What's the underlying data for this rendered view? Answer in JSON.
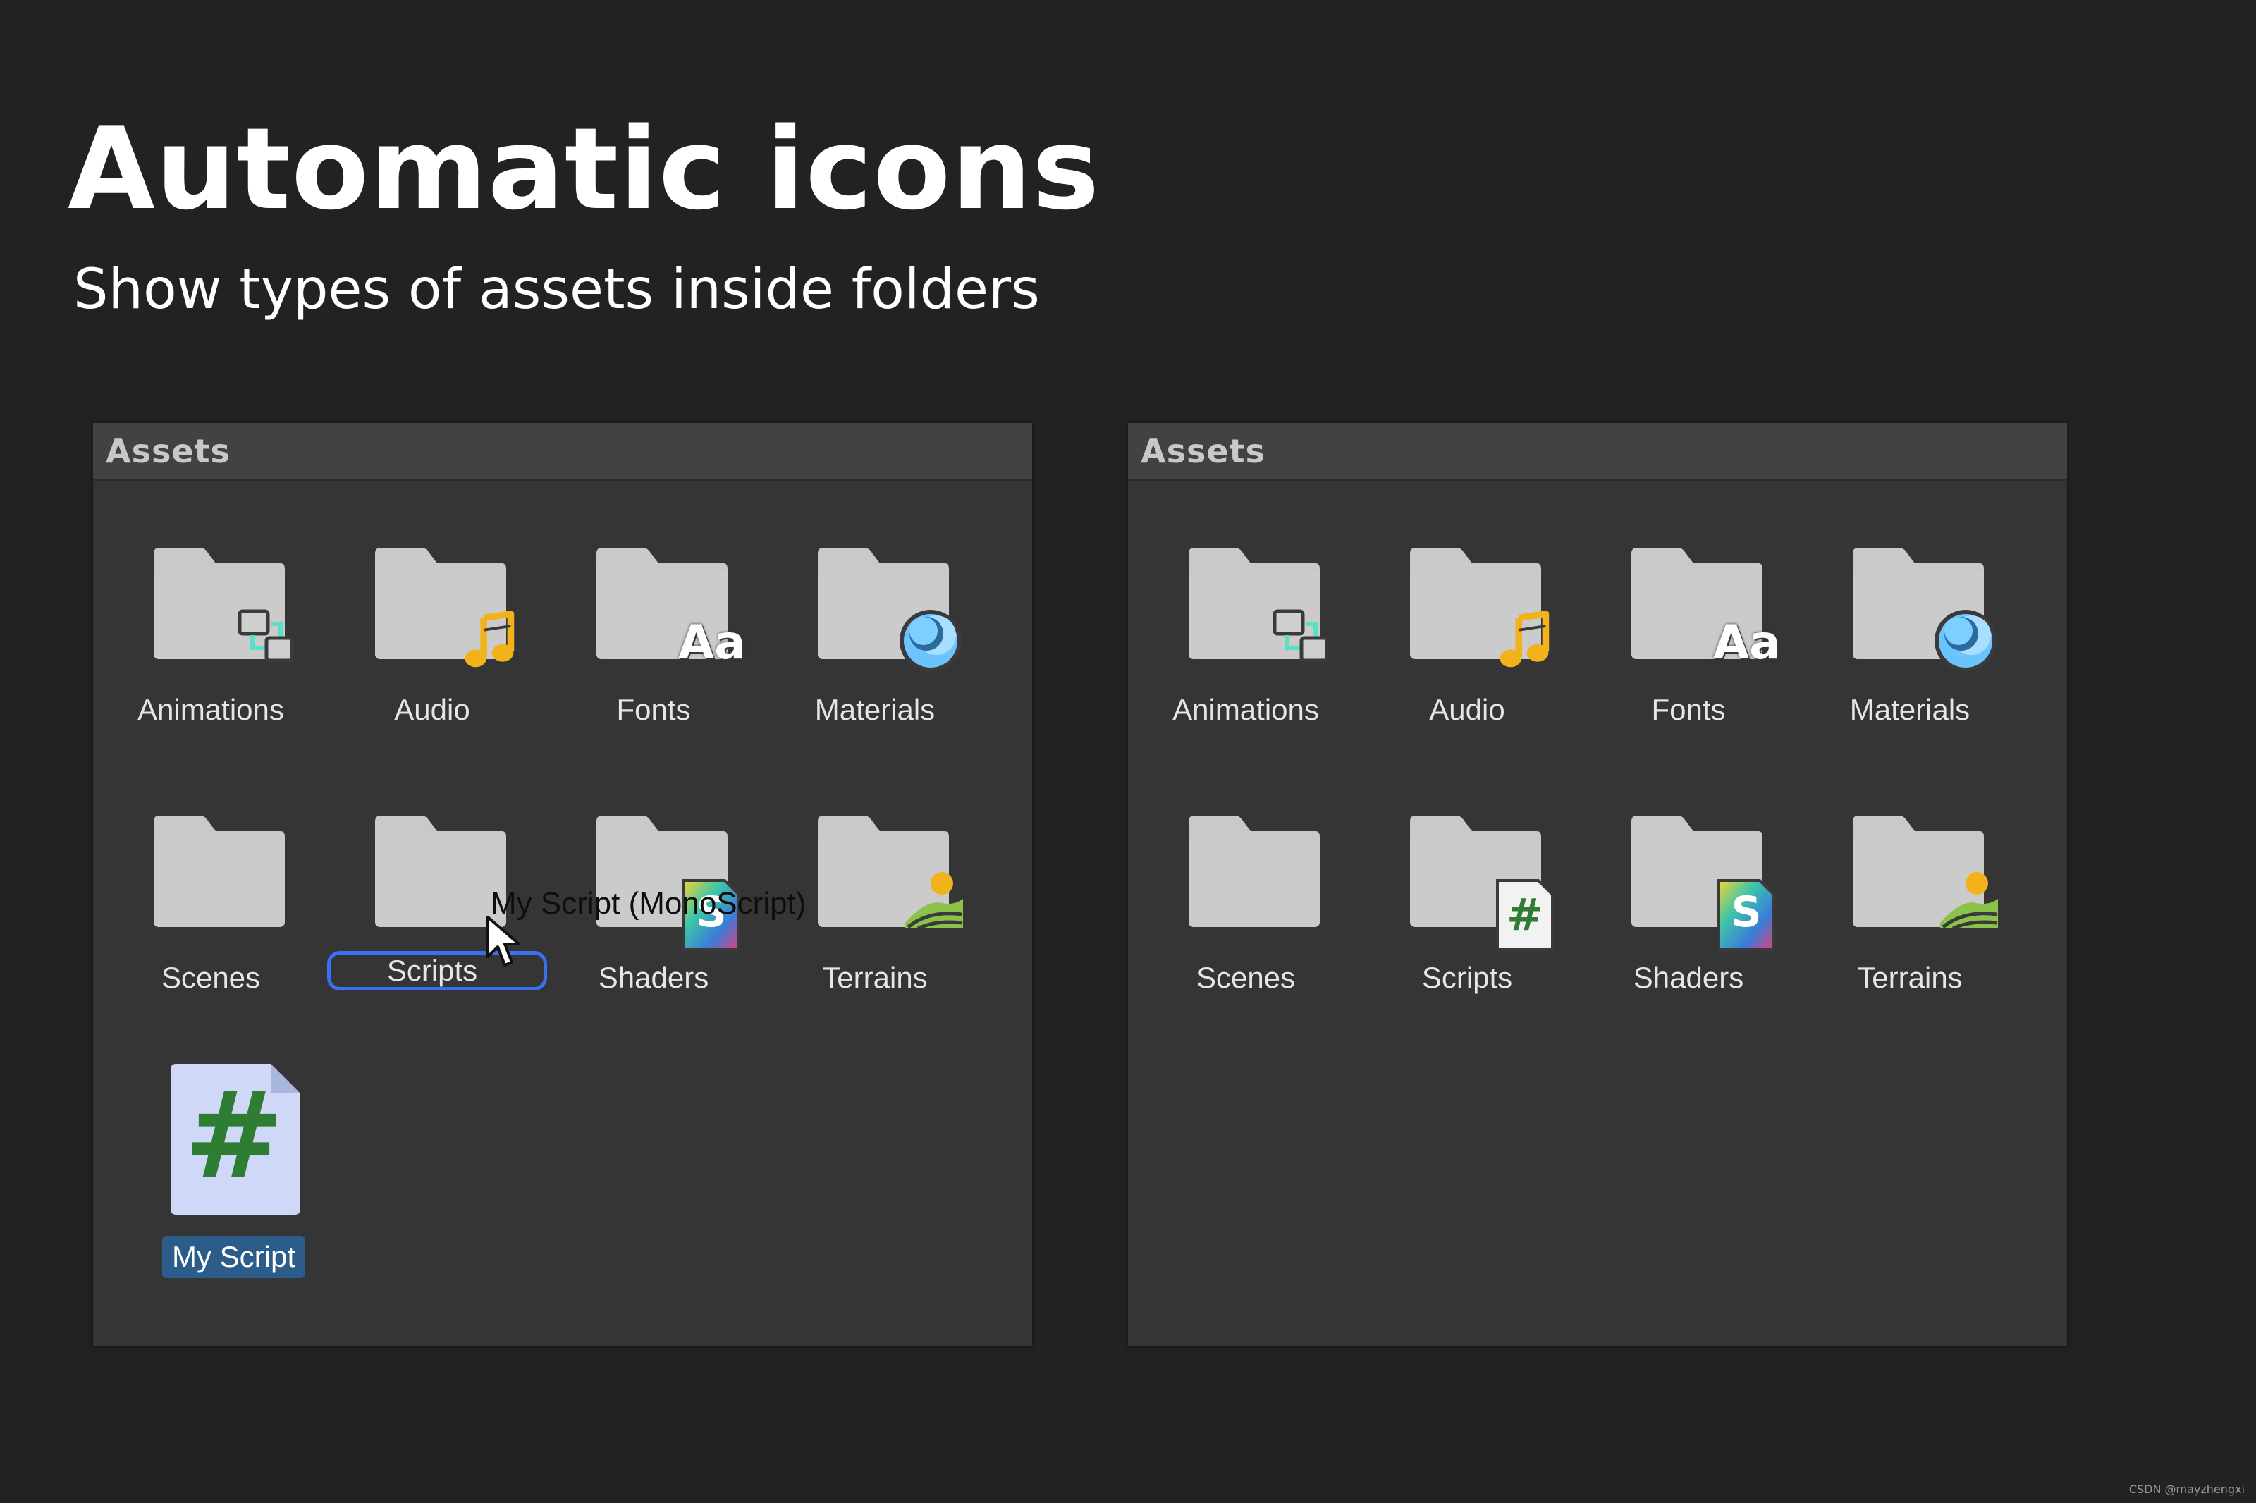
{
  "slide": {
    "title": "Automatic icons",
    "subtitle": "Show types of assets inside folders"
  },
  "panel_left": {
    "header": "Assets",
    "folders": [
      {
        "label": "Animations",
        "icon": "animation-icon"
      },
      {
        "label": "Audio",
        "icon": "audio-note-icon"
      },
      {
        "label": "Fonts",
        "icon": "font-aa-icon"
      },
      {
        "label": "Materials",
        "icon": "material-sphere-icon"
      },
      {
        "label": "Scenes",
        "icon": "none"
      },
      {
        "label": "Scripts",
        "icon": "none"
      },
      {
        "label": "Shaders",
        "icon": "shader-s-icon"
      },
      {
        "label": "Terrains",
        "icon": "terrain-icon"
      }
    ],
    "drag_tooltip": "My Script (MonoScript)",
    "script_file": {
      "label": "My Script",
      "glyph": "#"
    }
  },
  "panel_right": {
    "header": "Assets",
    "folders": [
      {
        "label": "Animations",
        "icon": "animation-icon"
      },
      {
        "label": "Audio",
        "icon": "audio-note-icon"
      },
      {
        "label": "Fonts",
        "icon": "font-aa-icon"
      },
      {
        "label": "Materials",
        "icon": "material-sphere-icon"
      },
      {
        "label": "Scenes",
        "icon": "none"
      },
      {
        "label": "Scripts",
        "icon": "script-hash-icon"
      },
      {
        "label": "Shaders",
        "icon": "shader-s-icon"
      },
      {
        "label": "Terrains",
        "icon": "terrain-icon"
      }
    ]
  },
  "badges": {
    "fonts_text": "Aa",
    "shader_text": "S",
    "script_text": "#"
  },
  "colors": {
    "background": "#222223",
    "panel": "#353536",
    "folder": "#c9c9c9",
    "selection": "#2c5d8a",
    "rename_outline": "#3a6ff2",
    "audio": "#f2b21b",
    "material": "#6cc4ff",
    "script_green": "#2e7d32"
  },
  "watermark": "CSDN @mayzhengxi"
}
